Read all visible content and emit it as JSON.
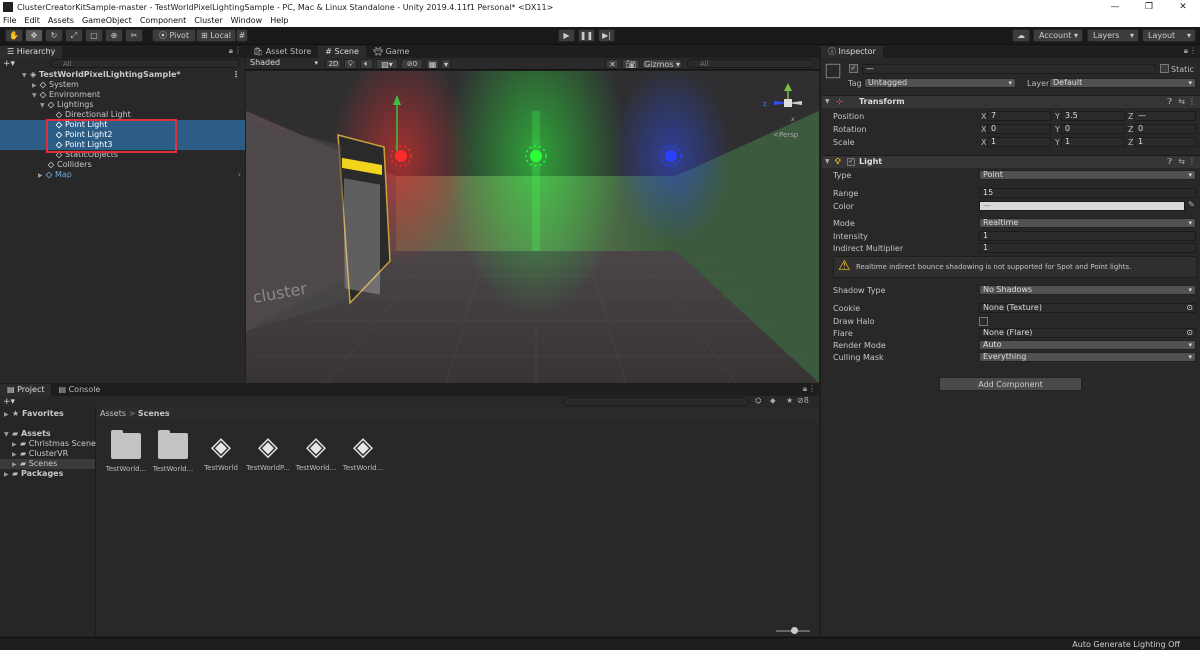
{
  "window": {
    "title": "ClusterCreatorKitSample-master - TestWorldPixelLightingSample - PC, Mac & Linux Standalone - Unity 2019.4.11f1 Personal* <DX11>",
    "controls": [
      "—",
      "❐",
      "✕"
    ]
  },
  "menu": [
    "File",
    "Edit",
    "Assets",
    "GameObject",
    "Component",
    "Cluster",
    "Window",
    "Help"
  ],
  "toolbar": {
    "pivot": "Pivot",
    "local": "Local",
    "account": "Account",
    "layers": "Layers",
    "layout": "Layout"
  },
  "hierarchy": {
    "tab": "Hierarchy",
    "search_placeholder": "All",
    "items": [
      {
        "label": "TestWorldPixelLightingSample*"
      },
      {
        "label": "System"
      },
      {
        "label": "Environment"
      },
      {
        "label": "Lightings"
      },
      {
        "label": "Directional Light"
      },
      {
        "label": "Point Light"
      },
      {
        "label": "Point Light2"
      },
      {
        "label": "Point Light3"
      },
      {
        "label": "StaticObjects"
      },
      {
        "label": "Colliders"
      },
      {
        "label": "Map"
      }
    ]
  },
  "scene": {
    "tabs": [
      "Asset Store",
      "Scene",
      "Game"
    ],
    "shading": "Shaded",
    "mode2d": "2D",
    "gizmos": "Gizmos",
    "search_placeholder": "All",
    "persp": "Persp",
    "fx_count": "0",
    "logo": "cluster"
  },
  "inspector": {
    "tab": "Inspector",
    "name_value": "—",
    "static_label": "Static",
    "tag_label": "Tag",
    "tag_value": "Untagged",
    "layer_label": "Layer",
    "layer_value": "Default",
    "transform": {
      "title": "Transform",
      "position_label": "Position",
      "rotation_label": "Rotation",
      "scale_label": "Scale",
      "position": [
        "7",
        "3.5",
        "—"
      ],
      "rotation": [
        "0",
        "0",
        "0"
      ],
      "scale": [
        "1",
        "1",
        "1"
      ],
      "axes": [
        "X",
        "Y",
        "Z"
      ]
    },
    "light": {
      "title": "Light",
      "type_label": "Type",
      "type_value": "Point",
      "range_label": "Range",
      "range_value": "15",
      "color_label": "Color",
      "color_value": "—",
      "mode_label": "Mode",
      "mode_value": "Realtime",
      "intensity_label": "Intensity",
      "intensity_value": "1",
      "indirect_label": "Indirect Multiplier",
      "indirect_value": "1",
      "warning": "Realtime indirect bounce shadowing is not supported for Spot and Point lights.",
      "shadow_label": "Shadow Type",
      "shadow_value": "No Shadows",
      "cookie_label": "Cookie",
      "cookie_value": "None (Texture)",
      "halo_label": "Draw Halo",
      "flare_label": "Flare",
      "flare_value": "None (Flare)",
      "render_label": "Render Mode",
      "render_value": "Auto",
      "culling_label": "Culling Mask",
      "culling_value": "Everything"
    },
    "add_component": "Add Component"
  },
  "project": {
    "tabs": [
      "Project",
      "Console"
    ],
    "favorites": "Favorites",
    "assets": "Assets",
    "folders": [
      "Christmas Scene",
      "ClusterVR",
      "Scenes"
    ],
    "packages": "Packages",
    "breadcrumb": [
      "Assets",
      "Scenes"
    ],
    "breadcrumb_sep": ">",
    "hidden_count": "8",
    "files": [
      {
        "name": "TestWorld...",
        "kind": "folder"
      },
      {
        "name": "TestWorld...",
        "kind": "folder"
      },
      {
        "name": "TestWorld",
        "kind": "unity"
      },
      {
        "name": "TestWorldP...",
        "kind": "unity"
      },
      {
        "name": "TestWorld...",
        "kind": "unity"
      },
      {
        "name": "TestWorld...",
        "kind": "unity"
      }
    ]
  },
  "status": {
    "text": "Auto Generate Lighting Off"
  },
  "colors": {
    "selection": "#2c5d87",
    "highlight_box": "#e0303a",
    "light_red": "#ff3030",
    "light_green": "#20ff30",
    "light_blue": "#2040ff"
  }
}
